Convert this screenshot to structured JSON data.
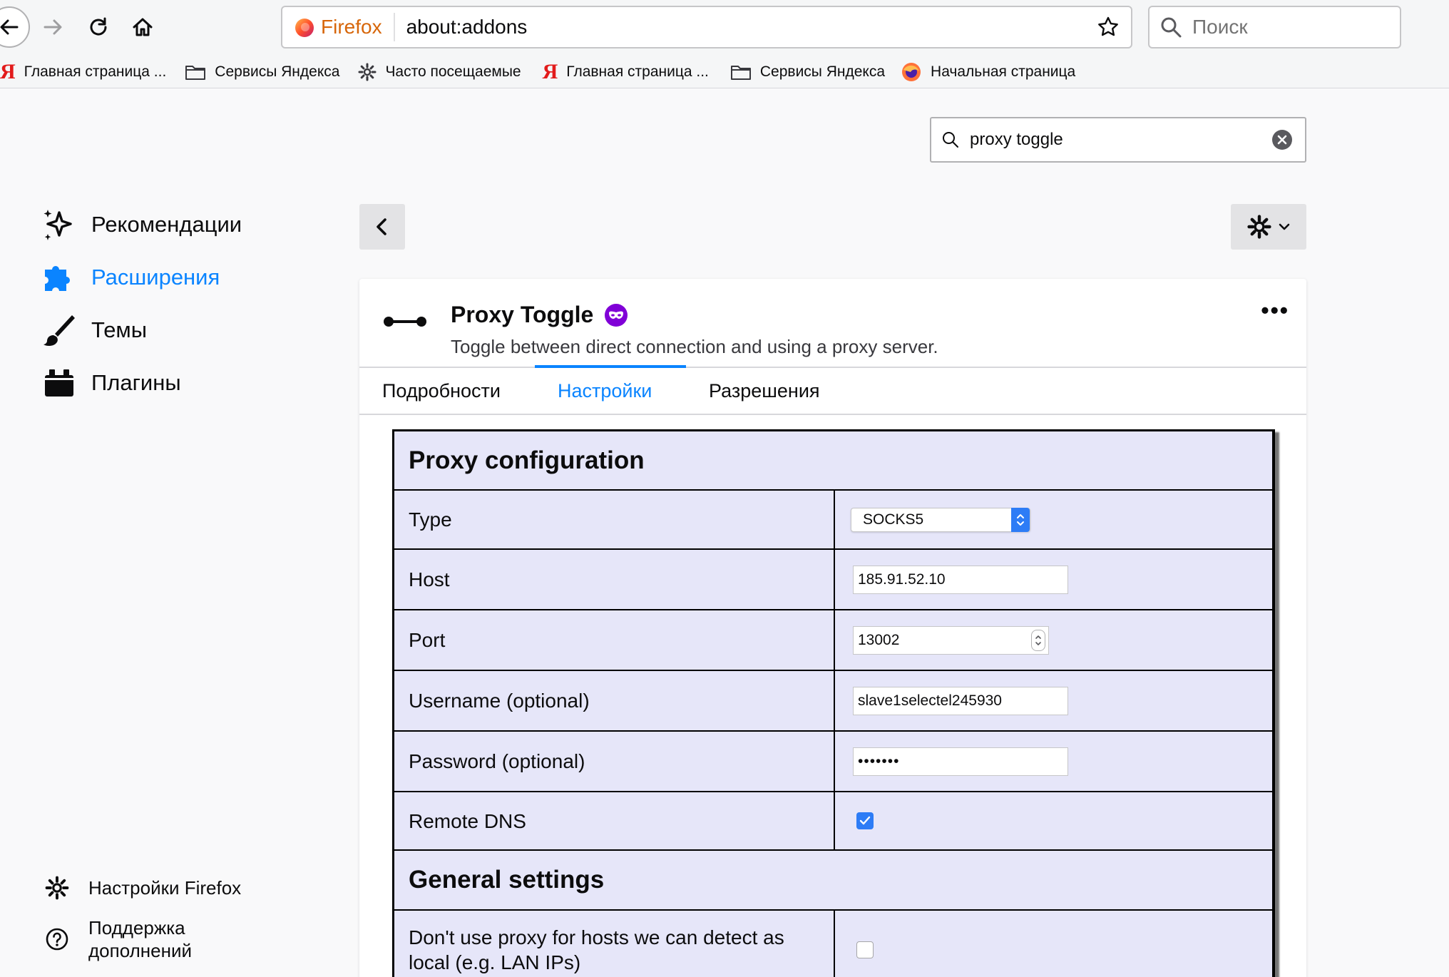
{
  "browser": {
    "identity_label": "Firefox",
    "url": "about:addons",
    "search_placeholder": "Поиск"
  },
  "bookmarks": [
    {
      "label": "Главная страница ...",
      "icon": "yandex-icon"
    },
    {
      "label": "Сервисы Яндекса",
      "icon": "folder-icon"
    },
    {
      "label": "Часто посещаемые",
      "icon": "gear-icon"
    },
    {
      "label": "Главная страница ...",
      "icon": "yandex-icon"
    },
    {
      "label": "Сервисы Яндекса",
      "icon": "folder-icon"
    },
    {
      "label": "Начальная страница",
      "icon": "firefox-icon"
    }
  ],
  "addon_search": {
    "value": "proxy toggle"
  },
  "sidebar": {
    "items": [
      {
        "label": "Рекомендации",
        "icon": "sparkle-icon"
      },
      {
        "label": "Расширения",
        "icon": "puzzle-icon",
        "active": true
      },
      {
        "label": "Темы",
        "icon": "brush-icon"
      },
      {
        "label": "Плагины",
        "icon": "plugin-icon"
      }
    ],
    "footer": [
      {
        "label": "Настройки Firefox",
        "icon": "gear-icon"
      },
      {
        "label": "Поддержка дополнений",
        "icon": "help-icon"
      }
    ]
  },
  "addon": {
    "name": "Proxy Toggle",
    "description": "Toggle between direct connection and using a proxy server.",
    "more_label": "•••"
  },
  "tabs": [
    {
      "label": "Подробности"
    },
    {
      "label": "Настройки",
      "selected": true
    },
    {
      "label": "Разрешения"
    }
  ],
  "options": {
    "proxy_title": "Proxy configuration",
    "rows": {
      "type": {
        "label": "Type",
        "value": "SOCKS5"
      },
      "host": {
        "label": "Host",
        "value": "185.91.52.10"
      },
      "port": {
        "label": "Port",
        "value": "13002"
      },
      "username": {
        "label": "Username (optional)",
        "value": "slave1selectel245930"
      },
      "password": {
        "label": "Password (optional)",
        "value": "•••••••"
      },
      "remote_dns": {
        "label": "Remote DNS",
        "checked": true
      }
    },
    "general_title": "General settings",
    "general_rows": {
      "no_local": {
        "label": "Don't use proxy for hosts we can detect as local (e.g. LAN IPs)",
        "checked": false
      }
    }
  },
  "colors": {
    "accent": "#0a84ff",
    "options_bg": "#e6e6f9",
    "private_badge": "#8000d7",
    "firefox_label": "#d7660a"
  }
}
